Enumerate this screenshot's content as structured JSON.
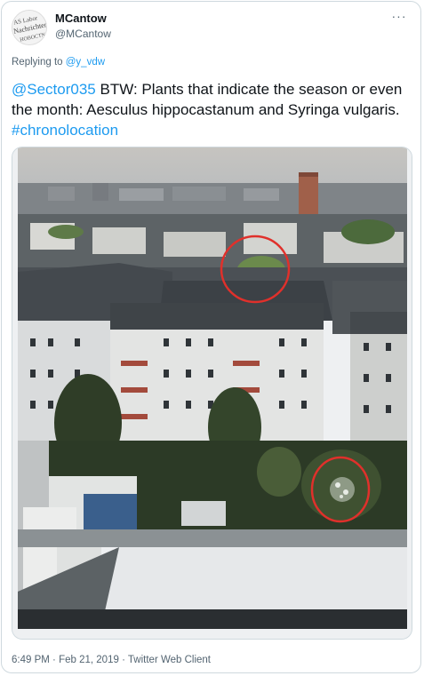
{
  "tweet": {
    "author_name": "MCantow",
    "author_handle": "@MCantow",
    "replying_prefix": "Replying to",
    "replying_to": "@y_vdw",
    "mention": "@Sector035",
    "text_main": " BTW: Plants that indicate the season or even the month: Aesculus hippocastanum and Syringa vulgaris. ",
    "hashtag": "#chronolocation",
    "time": "6:49 PM",
    "separator": "·",
    "date": "Feb 21, 2019",
    "client": "Twitter Web Client",
    "more_glyph": "···"
  },
  "avatar": {
    "line1": "AS Labor",
    "line2": "Nachrichten",
    "line3": "HOBOCTN"
  },
  "icons": {
    "more": "more-horizontal-icon"
  },
  "colors": {
    "link": "#1d9bf0",
    "text": "#0f1419",
    "secondary": "#536471",
    "annotation_circle": "#e0302b"
  }
}
